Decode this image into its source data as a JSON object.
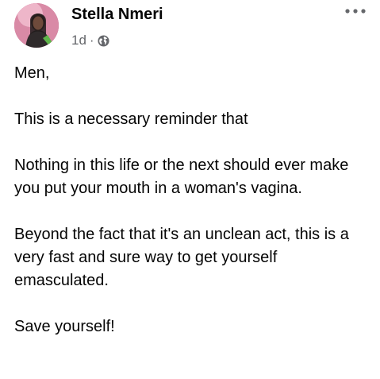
{
  "post": {
    "author": {
      "name": "Stella Nmeri",
      "avatar_icon": "profile-photo"
    },
    "timestamp": "1d",
    "separator": "·",
    "privacy_icon": "globe-icon",
    "more_icon": "more-horizontal-icon",
    "paragraphs": [
      "Men,",
      "This is a necessary reminder that",
      "Nothing in this life or the next should ever make you put your mouth in a woman's vagina.",
      "Beyond the fact that it's an unclean act, this is a very fast and sure way to get yourself emasculated.",
      "Save yourself!"
    ]
  },
  "colors": {
    "text_primary": "#050505",
    "text_secondary": "#65676b"
  }
}
